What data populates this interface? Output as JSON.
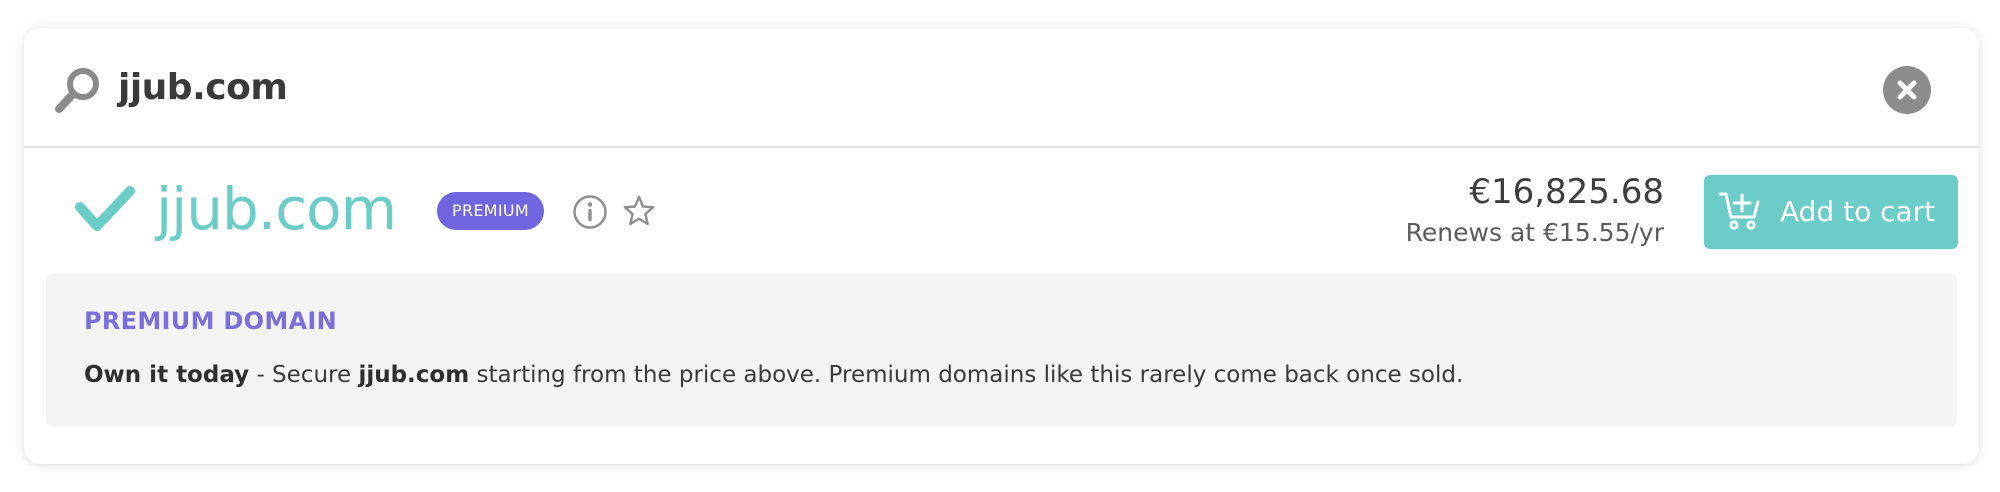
{
  "search": {
    "query": "jjub.com",
    "icon": "search-icon",
    "clear_icon": "close-icon"
  },
  "result": {
    "status_icon": "check-icon",
    "domain": "jjub.com",
    "badge": "PREMIUM",
    "info_icon": "info-icon",
    "favorite_icon": "star-icon",
    "price": "€16,825.68",
    "renewal": "Renews at €15.55/yr",
    "cart_button_label": "Add to cart",
    "cart_icon": "cart-add-icon"
  },
  "premium_panel": {
    "title": "PREMIUM DOMAIN",
    "lead": "Own it today",
    "text_1": " - Secure ",
    "domain": "jjub.com",
    "text_2": " starting from the price above. Premium domains like this rarely come back once sold."
  },
  "colors": {
    "accent_teal": "#6ccdc8",
    "premium_purple": "#7065df",
    "panel_title_purple": "#7b6fdc",
    "panel_background": "#f4f4f4"
  }
}
